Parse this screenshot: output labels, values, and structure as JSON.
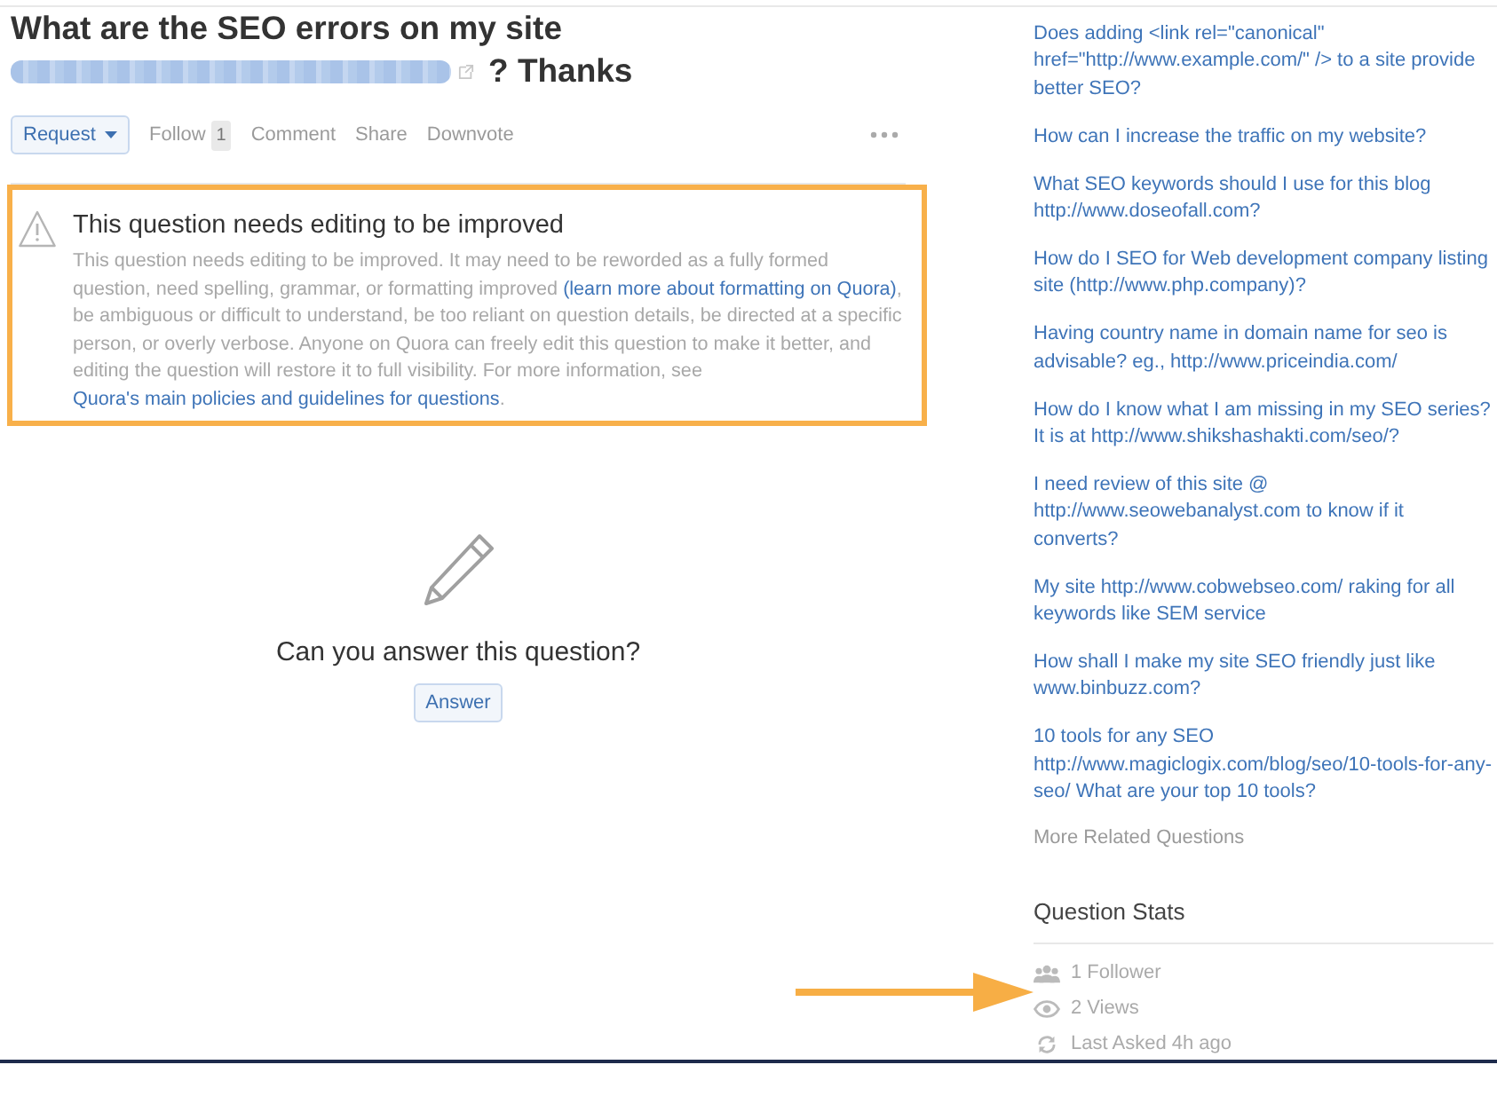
{
  "question": {
    "title": "What are the SEO errors on my site",
    "link_blurred": true,
    "title_end": "? Thanks"
  },
  "actions": [
    {
      "kind": "dropdown",
      "label": "Request"
    },
    {
      "kind": "counter",
      "label": "Follow",
      "count": "1"
    },
    {
      "kind": "link",
      "label": "Comment"
    },
    {
      "kind": "link",
      "label": "Share"
    },
    {
      "kind": "link",
      "label": "Downvote"
    },
    {
      "kind": "more"
    }
  ],
  "notice": {
    "title": "This question needs editing to be improved",
    "body": [
      {
        "kind": "text",
        "text": "This question needs editing to be improved. It may need to be reworded as a fully formed question, need spelling, grammar, or formatting improved "
      },
      {
        "kind": "link",
        "text": "(learn more about formatting on Quora)"
      },
      {
        "kind": "text",
        "text": ", be ambiguous or difficult to understand, be too reliant on question details, be directed at a specific person, or overly verbose. Anyone on Quora can freely edit this question to make it better, and editing the question will restore it to full visibility. For more information, see "
      },
      {
        "kind": "link",
        "text": "Quora's main policies and guidelines for questions"
      },
      {
        "kind": "text",
        "text": "."
      }
    ]
  },
  "answer_prompt": {
    "text": "Can you answer this question?",
    "button": "Answer"
  },
  "related_questions": {
    "items": [
      "Does adding <link rel=\"canonical\" href=\"http://www.example.com/\" /> to a site provide better SEO?",
      "How can I increase the traffic on my website?",
      "What SEO keywords should I use for this blog http://www.doseofall.com?",
      "How do I SEO for Web development company listing site (http://www.php.company)?",
      "Having country name in domain name for seo is advisable? eg., http://www.priceindia.com/",
      "How do I know what I am missing in my SEO series? It is at http://www.shikshashakti.com/seo/?",
      "I need review of this site @ http://www.seowebanalyst.com to know if it converts?",
      "My site http://www.cobwebseo.com/ raking for all keywords like SEM service",
      "How shall I make my site SEO friendly just like www.binbuzz.com?",
      "10 tools for any SEO http://www.magiclogix.com/blog/seo/10-tools-for-any-seo/ What are your top 10 tools?"
    ],
    "more": "More Related Questions"
  },
  "question_stats": {
    "title": "Question Stats",
    "rows": [
      {
        "kind": "followers",
        "text": "1 Follower"
      },
      {
        "kind": "views",
        "text": "2 Views"
      },
      {
        "kind": "last_asked",
        "text": "Last Asked 4h ago"
      }
    ]
  }
}
